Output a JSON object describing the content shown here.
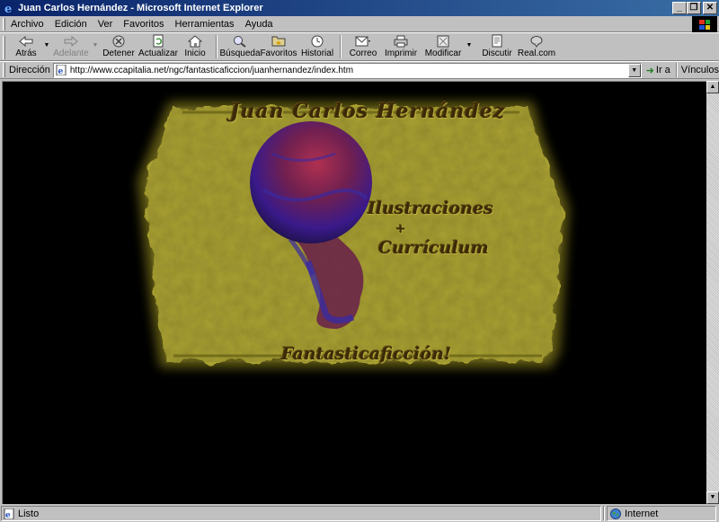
{
  "window": {
    "title": "Juan Carlos Hernández - Microsoft Internet Explorer",
    "buttons": {
      "minimize": "_",
      "restore": "❐",
      "close": "✕"
    }
  },
  "menu": [
    {
      "label": "Archivo",
      "accel": "A"
    },
    {
      "label": "Edición",
      "accel": "E"
    },
    {
      "label": "Ver",
      "accel": "V"
    },
    {
      "label": "Favoritos",
      "accel": "F"
    },
    {
      "label": "Herramientas",
      "accel": "H"
    },
    {
      "label": "Ayuda",
      "accel": "y"
    }
  ],
  "toolbar": {
    "back": "Atrás",
    "forward": "Adelante",
    "stop": "Detener",
    "refresh": "Actualizar",
    "home": "Inicio",
    "search": "Búsqueda",
    "favorites": "Favoritos",
    "history": "Historial",
    "mail": "Correo",
    "print": "Imprimir",
    "edit": "Modificar",
    "discuss": "Discutir",
    "realcom": "Real.com"
  },
  "address": {
    "label": "Dirección",
    "url": "http://www.ccapitalia.net/ngc/fantasticaficcion/juanhernandez/index.htm",
    "go": "Ir a",
    "links": "Vínculos"
  },
  "page": {
    "title_text": "Juan Carlos Hernández",
    "ilustraciones": "Ilustraciones",
    "plus": "+",
    "curriculum": "Currículum",
    "fantasticaficcion": "Fantasticaficción!"
  },
  "status": {
    "text": "Listo",
    "zone": "Internet"
  },
  "colors": {
    "titlebar_start": "#0a246a",
    "titlebar_end": "#3a6ea5",
    "chrome": "#c0c0c0",
    "content_bg": "#000000",
    "parchment": "#a8a030",
    "sphere": "#6a2040"
  }
}
